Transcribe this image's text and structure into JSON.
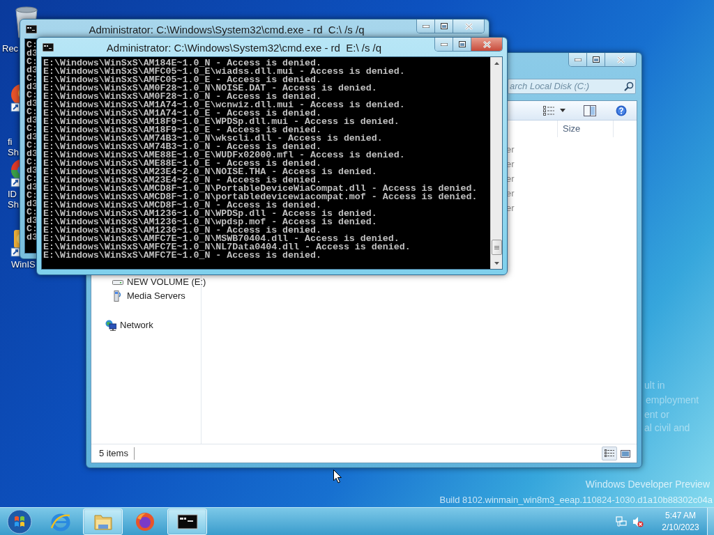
{
  "desktop_icons": [
    {
      "kind": "recycle",
      "label_lines": [
        "Rec"
      ]
    },
    {
      "kind": "fox",
      "label_lines": [
        "fi",
        "Sh"
      ]
    },
    {
      "kind": "orb",
      "label_lines": [
        "ID",
        "Sh"
      ]
    },
    {
      "kind": "disc",
      "label_lines": [
        "WinIS"
      ]
    }
  ],
  "wallpaper_notice": [
    "ult in",
    "employment",
    "ent or",
    "al civil and"
  ],
  "edition_text": {
    "name": "Windows Developer Preview",
    "build": "Build 8102.winmain_win8m3_eeap.110824-1030.d1a10b88302c04a"
  },
  "explorer": {
    "search": {
      "placeholder": "arch Local Disk (C:)"
    },
    "columns": [
      "Size"
    ],
    "rows": [
      "er",
      "er",
      "er",
      "er",
      "er"
    ],
    "nav_items": [
      {
        "kind": "drive",
        "label": "NEW VOLUME (E:)"
      },
      {
        "kind": "media",
        "label": "Media Servers"
      },
      {
        "kind": "network",
        "label": "Network"
      }
    ],
    "status": "5 items"
  },
  "cmd_back": {
    "title": "Administrator: C:\\Windows\\System32\\cmd.exe - rd  C:\\ /s /q",
    "lines": [
      "C:",
      "d3",
      "C:",
      "d3",
      "C:",
      "d3",
      "C:",
      "d3",
      "C:",
      "d3",
      "C:",
      "d3",
      "C:",
      "d3",
      "C:",
      "d3",
      "C:",
      "d3",
      "C:",
      "d3",
      "C:",
      "d3",
      "C:",
      "d3"
    ]
  },
  "cmd_front": {
    "title": "Administrator: C:\\Windows\\System32\\cmd.exe - rd  E:\\ /s /q",
    "lines": [
      "E:\\Windows\\WinSxS\\AM184E~1.0_N - Access is denied.",
      "E:\\Windows\\WinSxS\\AMFC05~1.0_E\\wiadss.dll.mui - Access is denied.",
      "E:\\Windows\\WinSxS\\AMFC05~1.0_E - Access is denied.",
      "E:\\Windows\\WinSxS\\AM0F28~1.0_N\\NOISE.DAT - Access is denied.",
      "E:\\Windows\\WinSxS\\AM0F28~1.0_N - Access is denied.",
      "E:\\Windows\\WinSxS\\AM1A74~1.0_E\\wcnwiz.dll.mui - Access is denied.",
      "E:\\Windows\\WinSxS\\AM1A74~1.0_E - Access is denied.",
      "E:\\Windows\\WinSxS\\AM18F9~1.0_E\\WPDSp.dll.mui - Access is denied.",
      "E:\\Windows\\WinSxS\\AM18F9~1.0_E - Access is denied.",
      "E:\\Windows\\WinSxS\\AM74B3~1.0_N\\wkscli.dll - Access is denied.",
      "E:\\Windows\\WinSxS\\AM74B3~1.0_N - Access is denied.",
      "E:\\Windows\\WinSxS\\AME88E~1.0_E\\WUDFx02000.mfl - Access is denied.",
      "E:\\Windows\\WinSxS\\AME88E~1.0_E - Access is denied.",
      "E:\\Windows\\WinSxS\\AM23E4~2.0_N\\NOISE.THA - Access is denied.",
      "E:\\Windows\\WinSxS\\AM23E4~2.0_N - Access is denied.",
      "E:\\Windows\\WinSxS\\AMCD8F~1.0_N\\PortableDeviceWiaCompat.dll - Access is denied.",
      "E:\\Windows\\WinSxS\\AMCD8F~1.0_N\\portabledevicewiacompat.mof - Access is denied.",
      "E:\\Windows\\WinSxS\\AMCD8F~1.0_N - Access is denied.",
      "E:\\Windows\\WinSxS\\AM1236~1.0_N\\WPDSp.dll - Access is denied.",
      "E:\\Windows\\WinSxS\\AM1236~1.0_N\\wpdsp.mof - Access is denied.",
      "E:\\Windows\\WinSxS\\AM1236~1.0_N - Access is denied.",
      "E:\\Windows\\WinSxS\\AMFC7E~1.0_N\\MSWB70404.dll - Access is denied.",
      "E:\\Windows\\WinSxS\\AMFC7E~1.0_N\\NL7Data0404.dll - Access is denied.",
      "E:\\Windows\\WinSxS\\AMFC7E~1.0_N - Access is denied."
    ]
  },
  "taskbar": {
    "items": [
      {
        "kind": "browser",
        "running": false
      },
      {
        "kind": "folder",
        "running": true
      },
      {
        "kind": "fox",
        "running": false
      },
      {
        "kind": "console",
        "running": true
      }
    ]
  },
  "clock": {
    "time": "5:47 AM",
    "date": "2/10/2023"
  }
}
